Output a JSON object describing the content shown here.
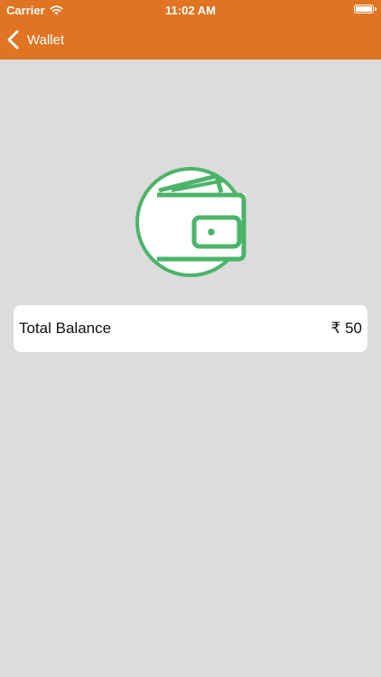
{
  "status_bar": {
    "carrier": "Carrier",
    "time": "11:02 AM",
    "wifi_icon": "wifi-icon",
    "battery_icon": "battery-icon"
  },
  "nav": {
    "back_icon": "chevron-left-icon",
    "title": "Wallet"
  },
  "wallet": {
    "icon": "wallet-icon",
    "accent_color": "#4cb46a"
  },
  "balance": {
    "label": "Total Balance",
    "amount": "₹ 50"
  },
  "colors": {
    "header": "#e07422",
    "background": "#dcdcdc",
    "card": "#ffffff"
  }
}
